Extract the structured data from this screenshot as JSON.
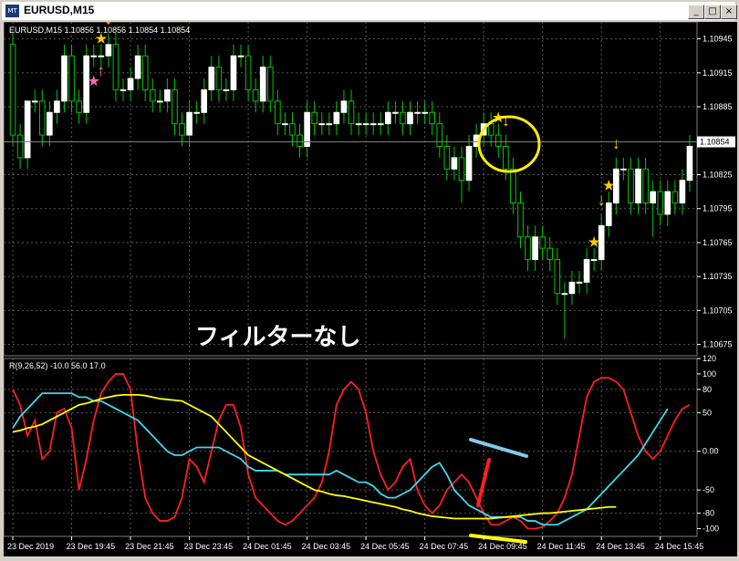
{
  "window": {
    "title": "EURUSD,M15",
    "icon": "chart-window-icon",
    "buttons": {
      "minimize": "_",
      "restore": "□",
      "close": "×"
    }
  },
  "colors": {
    "background": "#000000",
    "grid": "#5a5a5a",
    "bull_candle": "#ffffff",
    "bear_candle": "#ffffff",
    "wick": "#00c800",
    "current_price_line": "#808080",
    "signal_arrow": "#ffcc00",
    "buy_arrow": "#ff66b3",
    "highlight_circle": "#ffee00",
    "red_line": "#ff2020",
    "cyan_line": "#40d8ec",
    "yellow_line": "#ffff00",
    "annotation_bar_blue": "#88c8e8",
    "annotation_bar_red": "#ff2020"
  },
  "main_panel": {
    "info_label": "EURUSD,M15  1.10856 1.10856 1.10854 1.10854",
    "current_price": "1.10854",
    "annotation_text": "フィルターなし"
  },
  "sub_panel": {
    "info_label": "R(9,26,52) -10.0 56.0 17.0"
  },
  "chart_data": [
    {
      "type": "candlestick",
      "symbol": "EURUSD",
      "timeframe": "M15",
      "ylim": [
        1.10665,
        1.1096
      ],
      "y_tick_labels": [
        "1.10945",
        "1.10915",
        "1.10885",
        "1.10854",
        "1.10825",
        "1.10795",
        "1.10765",
        "1.10735",
        "1.10705",
        "1.10675"
      ],
      "x_tick_labels": [
        "23 Dec 2019",
        "23 Dec 19:45",
        "23 Dec 21:45",
        "23 Dec 23:45",
        "24 Dec 01:45",
        "24 Dec 03:45",
        "24 Dec 05:45",
        "24 Dec 07:45",
        "24 Dec 09:45",
        "24 Dec 11:45",
        "24 Dec 13:45",
        "24 Dec 15:45"
      ],
      "bar_time_labels": [
        "23 Dec 2019",
        "",
        "",
        "",
        "",
        "",
        "",
        "",
        "23 Dec 19:45",
        "",
        "",
        "",
        "",
        "",
        "",
        "",
        "23 Dec 21:45",
        "",
        "",
        "",
        "",
        "",
        "",
        "",
        "23 Dec 23:45",
        "",
        "",
        "",
        "",
        "",
        "",
        "",
        "24 Dec 01:45",
        "",
        "",
        "",
        "",
        "",
        "",
        "",
        "24 Dec 03:45",
        "",
        "",
        "",
        "",
        "",
        "",
        "",
        "24 Dec 05:45",
        "",
        "",
        "",
        "",
        "",
        "",
        "",
        "24 Dec 07:45",
        "",
        "",
        "",
        "",
        "",
        "",
        "",
        "24 Dec 09:45",
        "",
        "",
        "",
        "",
        "",
        "",
        "",
        "24 Dec 11:45",
        "",
        "",
        "",
        "",
        "",
        "",
        "",
        "24 Dec 13:45",
        "",
        "",
        "",
        "",
        "",
        "",
        "",
        "24 Dec 15:45",
        "",
        "",
        ""
      ],
      "open": [
        1.1094,
        1.1086,
        1.1084,
        1.1089,
        1.1089,
        1.1086,
        1.1088,
        1.1089,
        1.1093,
        1.1089,
        1.1088,
        1.1093,
        1.1093,
        1.1093,
        1.1094,
        1.109,
        1.109,
        1.1091,
        1.1093,
        1.109,
        1.1089,
        1.1089,
        1.109,
        1.1087,
        1.1086,
        1.1088,
        1.1088,
        1.109,
        1.1092,
        1.109,
        1.109,
        1.1093,
        1.1093,
        1.109,
        1.1089,
        1.1092,
        1.1089,
        1.1087,
        1.1087,
        1.1086,
        1.1085,
        1.1088,
        1.1087,
        1.1087,
        1.1087,
        1.1088,
        1.1089,
        1.1087,
        1.1087,
        1.1087,
        1.1087,
        1.1087,
        1.1088,
        1.1088,
        1.1087,
        1.1088,
        1.1088,
        1.1088,
        1.1087,
        1.1085,
        1.1083,
        1.1084,
        1.1082,
        1.1085,
        1.1086,
        1.1087,
        1.1086,
        1.1085,
        1.1083,
        1.108,
        1.1077,
        1.1075,
        1.1077,
        1.1076,
        1.1075,
        1.1072,
        1.1072,
        1.1073,
        1.1073,
        1.1075,
        1.1075,
        1.1078,
        1.108,
        1.1083,
        1.1083,
        1.108,
        1.1083,
        1.108,
        1.1081,
        1.1079,
        1.1081,
        1.108,
        1.1082
      ],
      "close": [
        1.1086,
        1.1084,
        1.1089,
        1.1089,
        1.1086,
        1.1088,
        1.1089,
        1.1093,
        1.1089,
        1.1088,
        1.1093,
        1.1093,
        1.1093,
        1.1094,
        1.109,
        1.109,
        1.1091,
        1.1093,
        1.109,
        1.1089,
        1.1089,
        1.109,
        1.1087,
        1.1086,
        1.1088,
        1.1088,
        1.109,
        1.1092,
        1.109,
        1.109,
        1.1093,
        1.1093,
        1.109,
        1.1089,
        1.1092,
        1.1089,
        1.1087,
        1.1087,
        1.1086,
        1.1085,
        1.1088,
        1.1087,
        1.1087,
        1.1087,
        1.1088,
        1.1089,
        1.1087,
        1.1087,
        1.1087,
        1.1087,
        1.1087,
        1.1088,
        1.1088,
        1.1087,
        1.1088,
        1.1088,
        1.1088,
        1.1087,
        1.1085,
        1.1083,
        1.1084,
        1.1082,
        1.1085,
        1.1086,
        1.1087,
        1.1086,
        1.1085,
        1.1083,
        1.108,
        1.1077,
        1.1075,
        1.1077,
        1.1076,
        1.1075,
        1.1072,
        1.1072,
        1.1073,
        1.1073,
        1.1075,
        1.1075,
        1.1078,
        1.108,
        1.1083,
        1.1083,
        1.108,
        1.1083,
        1.108,
        1.1081,
        1.1079,
        1.1081,
        1.108,
        1.1082,
        1.1085
      ],
      "high": [
        1.1095,
        1.1087,
        1.1089,
        1.109,
        1.109,
        1.1089,
        1.109,
        1.1094,
        1.1094,
        1.109,
        1.1094,
        1.1094,
        1.1094,
        1.1095,
        1.1095,
        1.1091,
        1.1092,
        1.1094,
        1.1094,
        1.1091,
        1.109,
        1.1091,
        1.1091,
        1.1088,
        1.1089,
        1.1089,
        1.1091,
        1.1093,
        1.1093,
        1.1091,
        1.1094,
        1.1094,
        1.1094,
        1.1091,
        1.1093,
        1.1093,
        1.109,
        1.1088,
        1.1088,
        1.1087,
        1.1089,
        1.1089,
        1.1088,
        1.1088,
        1.1089,
        1.109,
        1.109,
        1.1088,
        1.1088,
        1.1088,
        1.1088,
        1.1089,
        1.1089,
        1.1089,
        1.1089,
        1.1089,
        1.1089,
        1.1089,
        1.1088,
        1.1086,
        1.1085,
        1.1085,
        1.1086,
        1.1087,
        1.1088,
        1.1088,
        1.1087,
        1.1086,
        1.1084,
        1.1081,
        1.1078,
        1.1078,
        1.1078,
        1.1077,
        1.1076,
        1.1073,
        1.1074,
        1.1074,
        1.1076,
        1.1076,
        1.1079,
        1.1081,
        1.1084,
        1.1084,
        1.1084,
        1.1084,
        1.1084,
        1.1082,
        1.1082,
        1.1082,
        1.1082,
        1.1083,
        1.1086
      ],
      "low": [
        1.1085,
        1.1083,
        1.1083,
        1.1088,
        1.1085,
        1.1085,
        1.1087,
        1.1088,
        1.1088,
        1.1087,
        1.1087,
        1.1092,
        1.1092,
        1.1092,
        1.1089,
        1.1089,
        1.1089,
        1.109,
        1.1089,
        1.1088,
        1.1088,
        1.1088,
        1.1086,
        1.1085,
        1.1085,
        1.1087,
        1.1087,
        1.1089,
        1.1089,
        1.1089,
        1.1089,
        1.1092,
        1.1089,
        1.1088,
        1.1088,
        1.1088,
        1.1086,
        1.1086,
        1.1085,
        1.1084,
        1.1084,
        1.1086,
        1.1086,
        1.1086,
        1.1086,
        1.1087,
        1.1086,
        1.1086,
        1.1086,
        1.1086,
        1.1086,
        1.1086,
        1.1087,
        1.1086,
        1.1086,
        1.1087,
        1.1087,
        1.1086,
        1.1084,
        1.1082,
        1.1082,
        1.108,
        1.1081,
        1.1084,
        1.1085,
        1.1085,
        1.1084,
        1.1082,
        1.1079,
        1.1076,
        1.1074,
        1.1074,
        1.1075,
        1.1074,
        1.1071,
        1.1068,
        1.1071,
        1.1072,
        1.1072,
        1.1074,
        1.1074,
        1.1077,
        1.1079,
        1.1082,
        1.1079,
        1.1079,
        1.1079,
        1.1077,
        1.1078,
        1.1078,
        1.1079,
        1.1079,
        1.1081
      ],
      "markers": [
        {
          "index": 13,
          "kind": "sell-arrow",
          "label": "↓"
        },
        {
          "index": 12,
          "kind": "star",
          "label": "★"
        },
        {
          "index": 12,
          "kind": "buy-arrow",
          "label": "↑"
        },
        {
          "index": 11,
          "kind": "buy-star",
          "label": "★"
        },
        {
          "index": 66,
          "kind": "star",
          "label": "★"
        },
        {
          "index": 67,
          "kind": "sell-arrow",
          "label": "↓"
        },
        {
          "index": 80,
          "kind": "sell-arrow",
          "label": "↓"
        },
        {
          "index": 81,
          "kind": "star",
          "label": "★"
        },
        {
          "index": 82,
          "kind": "sell-arrow",
          "label": "↓"
        },
        {
          "index": 79,
          "kind": "star",
          "label": "★"
        }
      ]
    },
    {
      "type": "line",
      "indicator": "R(9,26,52)",
      "ylim": [
        -110,
        120
      ],
      "y_tick_labels": [
        "120",
        "100",
        "80",
        "50",
        "0.00",
        "-50",
        "-80",
        "-100"
      ],
      "x_tick_labels": [
        "23 Dec 2019",
        "23 Dec 19:45",
        "23 Dec 21:45",
        "23 Dec 23:45",
        "24 Dec 01:45",
        "24 Dec 03:45",
        "24 Dec 05:45",
        "24 Dec 07:45",
        "24 Dec 09:45",
        "24 Dec 11:45",
        "24 Dec 13:45",
        "24 Dec 15:45"
      ],
      "levels": [
        80,
        50,
        0,
        -50,
        -80
      ],
      "series": [
        {
          "values": [
            80,
            60,
            20,
            40,
            -10,
            0,
            50,
            55,
            30,
            -50,
            -10,
            40,
            75,
            90,
            100,
            100,
            80,
            0,
            -60,
            -80,
            -90,
            -90,
            -85,
            -60,
            -10,
            -20,
            -40,
            0,
            40,
            60,
            60,
            30,
            -30,
            -60,
            -70,
            -80,
            -90,
            -95,
            -90,
            -80,
            -70,
            -60,
            -40,
            0,
            60,
            80,
            90,
            80,
            50,
            0,
            -30,
            -50,
            -40,
            -20,
            -10,
            -50,
            -70,
            -80,
            -70,
            -50,
            -40,
            -30,
            -40,
            -60,
            -80,
            -95,
            -95,
            -90,
            -85,
            -90,
            -100,
            -100,
            -98,
            -90,
            -80,
            -60,
            -30,
            20,
            70,
            90,
            95,
            95,
            90,
            80,
            50,
            20,
            0,
            -10,
            0,
            20,
            40,
            55,
            60
          ]
        },
        {
          "values": [
            30,
            45,
            55,
            65,
            75,
            75,
            75,
            75,
            75,
            70,
            70,
            65,
            65,
            60,
            55,
            50,
            45,
            40,
            30,
            20,
            10,
            0,
            -5,
            -5,
            0,
            5,
            5,
            5,
            5,
            0,
            -5,
            -10,
            -20,
            -25,
            -25,
            -25,
            -25,
            -30,
            -30,
            -30,
            -30,
            -30,
            -30,
            -30,
            -25,
            -30,
            -35,
            -40,
            -40,
            -45,
            -55,
            -60,
            -60,
            -55,
            -50,
            -40,
            -30,
            -20,
            -15,
            -30,
            -50,
            -60,
            -70,
            -75,
            -80,
            -85,
            -85,
            -85,
            -85,
            -85,
            -90,
            -90,
            -95,
            -95,
            -95,
            -90,
            -85,
            -80,
            -75,
            -65,
            -55,
            -45,
            -35,
            -25,
            -15,
            -5,
            10,
            25,
            40,
            55
          ]
        },
        {
          "values": [
            25,
            27,
            30,
            32,
            35,
            40,
            45,
            50,
            55,
            60,
            62,
            65,
            68,
            70,
            72,
            73,
            73,
            73,
            72,
            70,
            68,
            67,
            66,
            65,
            60,
            55,
            50,
            45,
            35,
            25,
            15,
            5,
            -5,
            -10,
            -15,
            -20,
            -25,
            -30,
            -35,
            -40,
            -45,
            -50,
            -52,
            -55,
            -57,
            -58,
            -60,
            -62,
            -64,
            -66,
            -68,
            -70,
            -72,
            -75,
            -77,
            -80,
            -82,
            -84,
            -85,
            -86,
            -87,
            -87,
            -87,
            -87,
            -87,
            -87,
            -86,
            -85,
            -84,
            -83,
            -82,
            -81,
            -80,
            -80,
            -79,
            -78,
            -77,
            -76,
            -75,
            -74,
            -73,
            -72,
            -72
          ]
        }
      ]
    }
  ]
}
